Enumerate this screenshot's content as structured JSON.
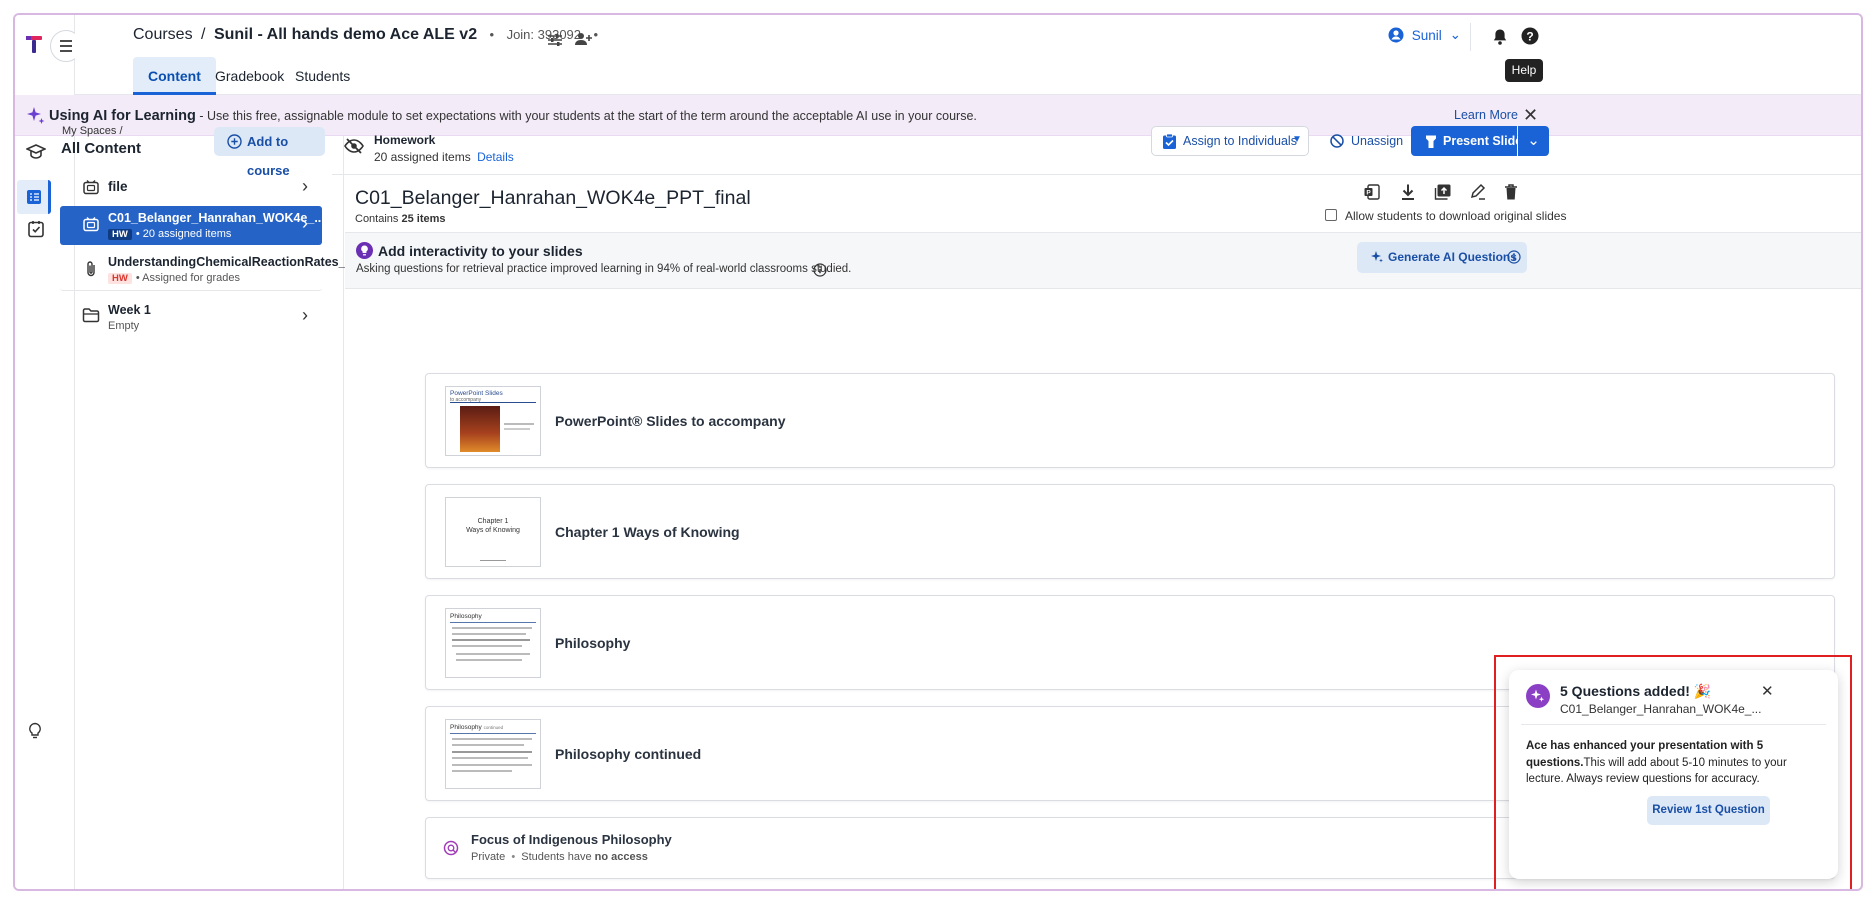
{
  "header": {
    "breadcrumb_courses": "Courses",
    "breadcrumb_sep": "/",
    "course_name": "Sunil - All hands demo Ace ALE v2",
    "join_label": "Join: 393092",
    "user_name": "Sunil",
    "help_tooltip": "Help"
  },
  "tabs": [
    {
      "label": "Content"
    },
    {
      "label": "Gradebook"
    },
    {
      "label": "Students"
    }
  ],
  "banner": {
    "title": "Using AI for Learning",
    "text": " - Use this free, assignable module to set expectations with your students at the start of the term around the acceptable AI use in your course.",
    "learn_more": "Learn More"
  },
  "sidebar": {
    "breadcrumb": "My Spaces /",
    "title": "All Content",
    "add_button": "Add to course",
    "items": [
      {
        "title": "file",
        "badge": "",
        "subtitle": ""
      },
      {
        "title": "C01_Belanger_Hanrahan_WOK4e_...",
        "badge": "HW",
        "subtitle": "• 20 assigned items"
      },
      {
        "title": "UnderstandingChemicalReactionRates_...",
        "badge": "HW",
        "subtitle": "• Assigned for grades"
      },
      {
        "title": "Week 1",
        "badge": "",
        "subtitle": "Empty"
      }
    ]
  },
  "toolbar": {
    "homework_label": "Homework",
    "assigned_count": "20 assigned items",
    "details_link": "Details",
    "assign_button": "Assign to Individuals",
    "unassign_button": "Unassign",
    "present_button": "Present Slides"
  },
  "deck": {
    "title": "C01_Belanger_Hanrahan_WOK4e_PPT_final",
    "contains_prefix": "Contains ",
    "contains_count": "25 items",
    "allow_download": "Allow students to download original slides"
  },
  "interactivity": {
    "title": "Add interactivity to your slides",
    "text": "Asking questions for retrieval practice improved learning in 94% of real-world classrooms studied.",
    "generate_button": "Generate AI Questions"
  },
  "slides": [
    {
      "title": "PowerPoint® Slides to accompany",
      "thumb_title": "PowerPoint Slides",
      "thumb_sub": "to accompany"
    },
    {
      "title": "Chapter 1 Ways of Knowing",
      "thumb_title": "Chapter 1",
      "thumb_sub": "Ways of Knowing"
    },
    {
      "title": "Philosophy",
      "thumb_title": "Philosophy",
      "thumb_sub": ""
    },
    {
      "title": "Philosophy continued",
      "thumb_title": "Philosophy",
      "thumb_sub": "continued"
    }
  ],
  "question_item": {
    "title": "Focus of Indigenous Philosophy",
    "meta_private": "Private",
    "meta_sep": "•",
    "meta_students": "Students have",
    "meta_access": "no access"
  },
  "toast": {
    "title": "5 Questions added!",
    "emoji": "🎉",
    "subtitle": "C01_Belanger_Hanrahan_WOK4e_...",
    "body_bold": "Ace has enhanced your presentation with 5 questions.",
    "body_rest": "This will add about 5-10 minutes to your lecture. Always review questions for accuracy.",
    "review_button": "Review 1st Question"
  },
  "colors": {
    "primary": "#1a63d6",
    "banner_bg": "#f3ebf8",
    "hw_badge": "#d9382f",
    "highlight_box": "#e02020"
  }
}
